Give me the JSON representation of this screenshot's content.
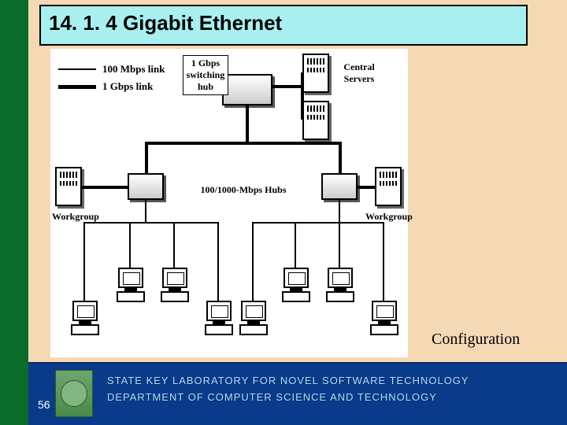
{
  "title": "14. 1. 4 Gigabit Ethernet",
  "caption": "Configuration",
  "page_number": "56",
  "footer": {
    "line1": "STATE KEY LABORATORY FOR NOVEL SOFTWARE TECHNOLOGY",
    "line2": "DEPARTMENT OF COMPUTER SCIENCE AND TECHNOLOGY"
  },
  "legend": {
    "thin": "100 Mbps link",
    "thick": "1 Gbps link"
  },
  "labels": {
    "central_hub": "1 Gbps switching hub",
    "central_servers": "Central Servers",
    "mid_hubs": "100/1000-Mbps Hubs",
    "workgroup_left": "Workgroup",
    "workgroup_right": "Workgroup"
  },
  "diagram": {
    "central_hub": 1,
    "central_servers": 2,
    "second_level_hubs": 2,
    "workgroup_servers": 2,
    "workstations_per_group": 4,
    "link_types": [
      "1 Gbps",
      "100 Mbps"
    ]
  }
}
